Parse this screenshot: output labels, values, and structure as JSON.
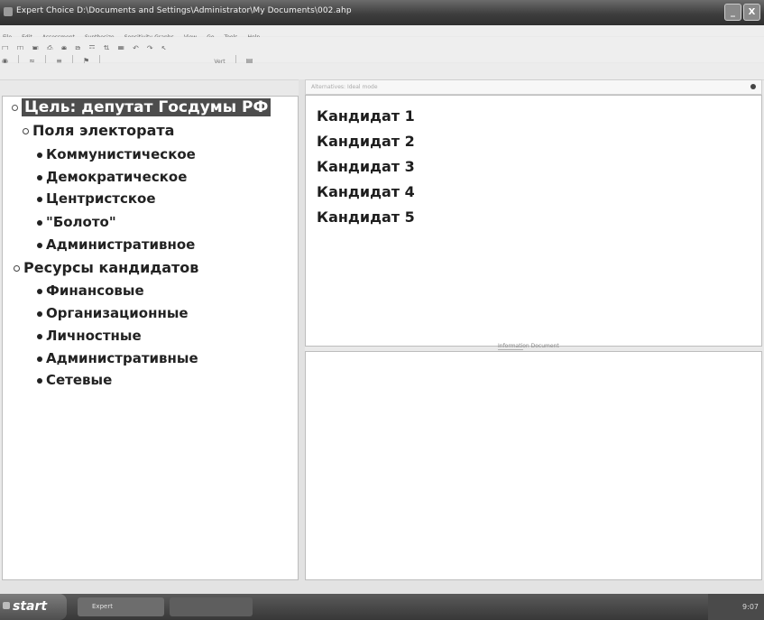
{
  "window": {
    "title": "Expert Choice   D:\\Documents and Settings\\Administrator\\My Documents\\002.ahp",
    "minimize": "_",
    "close": "X"
  },
  "menubar": {
    "items": [
      "File",
      "Edit",
      "Assessment",
      "Synthesize",
      "Sensitivity-Graphs",
      "View",
      "Go",
      "Tools",
      "Help"
    ]
  },
  "toolbar2": {
    "text": "Vert"
  },
  "left_pane": {
    "goal": "Цель: депутат Госдумы РФ",
    "groups": [
      {
        "label": "Поля электората",
        "children": [
          "Коммунистическое",
          "Демократическое",
          "Центристское",
          "\"Болото\"",
          "Административное"
        ]
      },
      {
        "label": "Ресурсы кандидатов",
        "children": [
          "Финансовые",
          "Организационные",
          "Личностные",
          "Административные",
          "Сетевые"
        ]
      }
    ]
  },
  "right_top": {
    "header": "Alternatives: Ideal mode",
    "candidates": [
      "Кандидат 1",
      "Кандидат 2",
      "Кандидат 3",
      "Кандидат 4",
      "Кандидат 5"
    ]
  },
  "right_bottom": {
    "header": "Information Document"
  },
  "taskbar": {
    "start": "start",
    "tasks": [
      "Expert",
      ""
    ],
    "tray_time": "9:07"
  }
}
